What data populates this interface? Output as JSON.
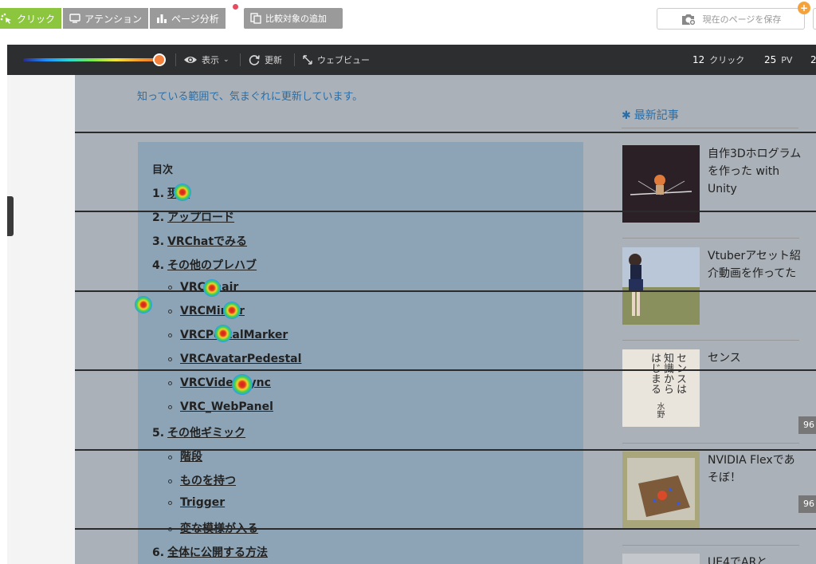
{
  "topbar": {
    "tabs": [
      {
        "label": "クリック",
        "icon": "click-icon",
        "active": true
      },
      {
        "label": "アテンション",
        "icon": "screen-icon",
        "active": false
      },
      {
        "label": "ページ分析",
        "icon": "bar-chart-icon",
        "active": false
      }
    ],
    "compare_label": "比較対象の追加",
    "save_label": "現在のページを保存",
    "plus_badge": "+"
  },
  "toolbar": {
    "view_label": "表示",
    "refresh_label": "更新",
    "webview_label": "ウェブビュー",
    "click_count": "12",
    "click_unit": "クリック",
    "pv_count": "25",
    "pv_unit": "PV",
    "trailing": "2"
  },
  "page": {
    "tagline": "知っている範囲で、気まぐれに更新しています。",
    "toc_title": "目次",
    "toc": [
      {
        "num": "1.",
        "text": "現在",
        "level": 1
      },
      {
        "num": "2.",
        "text": "アップロード",
        "level": 1
      },
      {
        "num": "3.",
        "text": "VRChatでみる",
        "level": 1
      },
      {
        "num": "4.",
        "text": "その他のプレハブ",
        "level": 1
      },
      {
        "num": "",
        "text": "VRCChair",
        "level": 2
      },
      {
        "num": "",
        "text": "VRCMirror",
        "level": 2
      },
      {
        "num": "",
        "text": "VRCPortalMarker",
        "level": 2
      },
      {
        "num": "",
        "text": "VRCAvatarPedestal",
        "level": 2
      },
      {
        "num": "",
        "text": "VRCVideoSync",
        "level": 2
      },
      {
        "num": "",
        "text": "VRC_WebPanel",
        "level": 2
      },
      {
        "num": "5.",
        "text": "その他ギミック",
        "level": 1
      },
      {
        "num": "",
        "text": "階段",
        "level": 2
      },
      {
        "num": "",
        "text": "ものを持つ",
        "level": 2
      },
      {
        "num": "",
        "text": "Trigger",
        "level": 2
      },
      {
        "num": "",
        "text": "変な模様が入る",
        "level": 2
      },
      {
        "num": "6.",
        "text": "全体に公開する方法",
        "level": 1
      }
    ],
    "sidebar_heading_mark": "✱",
    "sidebar_heading": "最新記事",
    "articles": [
      {
        "title": "自作3Dホログラムを作った with Unity"
      },
      {
        "title": "Vtuberアセット紹介動画を作ってた"
      },
      {
        "title": "センス",
        "pv": "96"
      },
      {
        "title": "NVIDIA Flexであそぼ！",
        "pv": "96"
      },
      {
        "title": "UE4でARと"
      }
    ],
    "book_cover_text": "センスは知識からはじまる",
    "book_author": "水野"
  },
  "colors": {
    "accent_green": "#8cc63f",
    "toolbar_bg": "#2d2e30",
    "link_blue": "#2a6ea8",
    "badge_orange": "#f4a23c"
  }
}
